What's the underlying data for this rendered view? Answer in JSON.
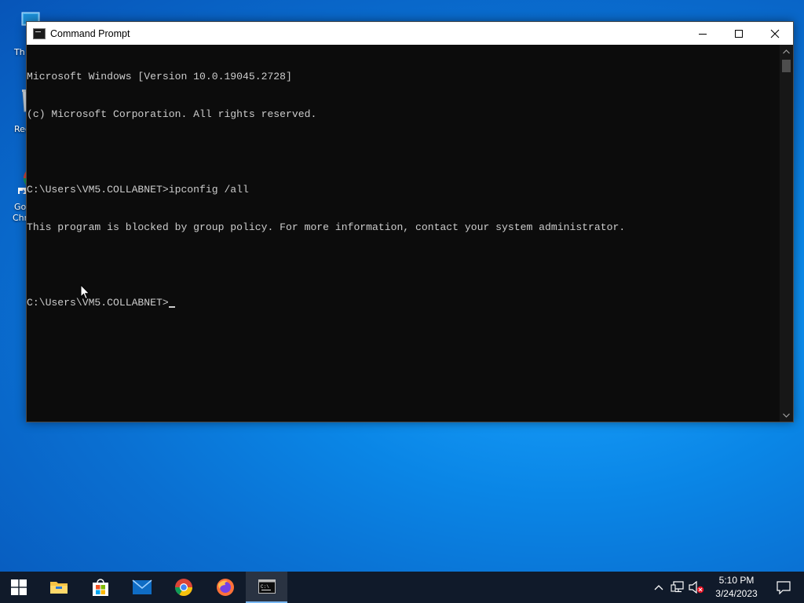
{
  "desktop": {
    "icons": [
      {
        "label": "Th",
        "icon": "this-pc-icon"
      },
      {
        "label": "Recy",
        "icon": "recycle-bin-icon"
      },
      {
        "label_line1": "Go",
        "label_line2": "Chr",
        "icon": "google-chrome-shortcut-icon"
      }
    ]
  },
  "window": {
    "title": "Command Prompt",
    "icon": "cmd-icon",
    "controls": {
      "minimize": "minimize-icon",
      "maximize": "maximize-icon",
      "close": "close-icon"
    },
    "console_lines": [
      "Microsoft Windows [Version 10.0.19045.2728]",
      "(c) Microsoft Corporation. All rights reserved.",
      "",
      "C:\\Users\\VM5.COLLABNET>ipconfig /all",
      "This program is blocked by group policy. For more information, contact your system administrator.",
      ""
    ],
    "prompt": "C:\\Users\\VM5.COLLABNET>",
    "colors": {
      "background": "#0c0c0c",
      "text": "#cccccc",
      "titlebar": "#ffffff"
    }
  },
  "taskbar": {
    "start": "windows-start-icon",
    "pinned": [
      {
        "name": "file-explorer",
        "icon": "folder-icon"
      },
      {
        "name": "microsoft-store",
        "icon": "store-icon"
      },
      {
        "name": "mail",
        "icon": "mail-icon"
      },
      {
        "name": "google-chrome",
        "icon": "chrome-icon"
      },
      {
        "name": "firefox",
        "icon": "firefox-icon"
      },
      {
        "name": "command-prompt",
        "icon": "cmd-icon",
        "active": true
      }
    ],
    "tray": {
      "icons": [
        "chevron-up-icon",
        "network-icon",
        "volume-muted-icon"
      ],
      "time": "5:10 PM",
      "date": "3/24/2023",
      "notifications": "notification-icon"
    }
  }
}
